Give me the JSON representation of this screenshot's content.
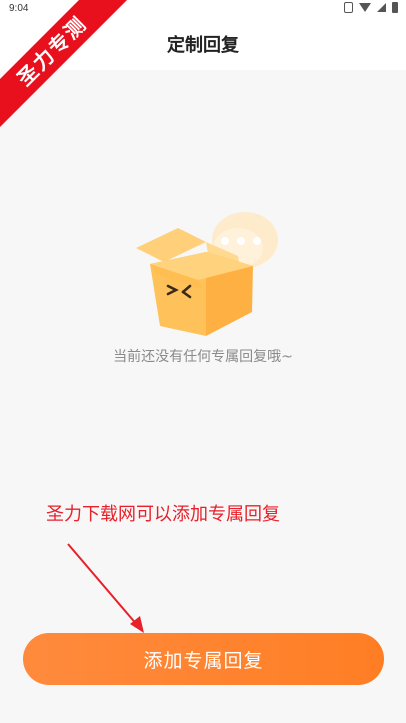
{
  "status_bar": {
    "time": "9:04"
  },
  "header": {
    "title": "定制回复"
  },
  "watermark": {
    "text": "圣力专测"
  },
  "empty_state": {
    "illustration": "empty-box-chat-icon",
    "message": "当前还没有任何专属回复哦~"
  },
  "annotation": {
    "text": "圣力下载网可以添加专属回复"
  },
  "actions": {
    "add_label": "添加专属回复"
  },
  "colors": {
    "accent": "#ff7f24",
    "annotation": "#e8202a",
    "banner": "#e8101c"
  }
}
